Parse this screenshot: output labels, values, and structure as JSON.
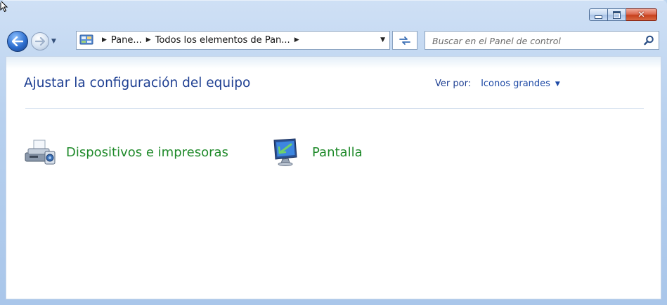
{
  "window": {
    "caption_buttons": [
      "minimize",
      "maximize",
      "close"
    ]
  },
  "nav": {
    "breadcrumbs": [
      "Pane...",
      "Todos los elementos de Pan..."
    ],
    "search": {
      "placeholder": "Buscar en el Panel de control"
    }
  },
  "main": {
    "title": "Ajustar la configuración del equipo",
    "view_by": {
      "label": "Ver por:",
      "value": "Iconos grandes"
    },
    "items": [
      {
        "label": "Dispositivos e impresoras",
        "icon": "printer-icon"
      },
      {
        "label": "Pantalla",
        "icon": "monitor-icon"
      }
    ]
  },
  "colors": {
    "link_green": "#1f8a2a",
    "title_blue": "#1e3f92",
    "frame_blue": "#b7d0ee"
  }
}
